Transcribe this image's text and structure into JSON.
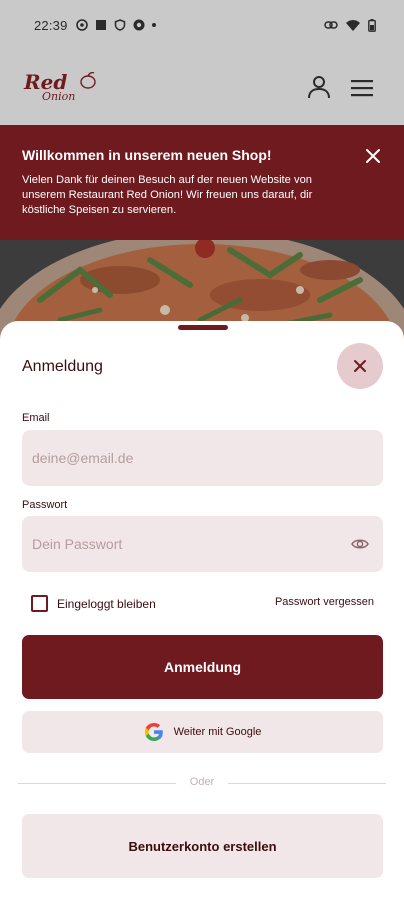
{
  "status_bar": {
    "time": "22:39"
  },
  "header": {
    "logo_top": "Red",
    "logo_bottom": "Onion"
  },
  "banner": {
    "title": "Willkommen in unserem neuen Shop!",
    "text": "Vielen Dank für deinen Besuch auf der neuen Website von unserem Restaurant Red Onion! Wir freuen uns darauf, dir köstliche Speisen zu servieren."
  },
  "login": {
    "title": "Anmeldung",
    "email_label": "Email",
    "email_placeholder": "deine@email.de",
    "email_value": "",
    "password_label": "Passwort",
    "password_placeholder": "Dein Passwort",
    "password_value": "",
    "remember_label": "Eingeloggt bleiben",
    "remember_checked": false,
    "forgot_label": "Passwort vergessen",
    "submit_label": "Anmeldung",
    "google_label": "Weiter mit Google",
    "divider_label": "Oder",
    "register_label": "Benutzerkonto erstellen"
  },
  "colors": {
    "brand": "#6e1a1f",
    "field_bg": "#f2e7e8",
    "close_bg": "#e5cbcd",
    "overlay": "#c9c9c9"
  },
  "icons": [
    "user-icon",
    "menu-icon",
    "close-icon",
    "eye-icon",
    "google-icon"
  ]
}
